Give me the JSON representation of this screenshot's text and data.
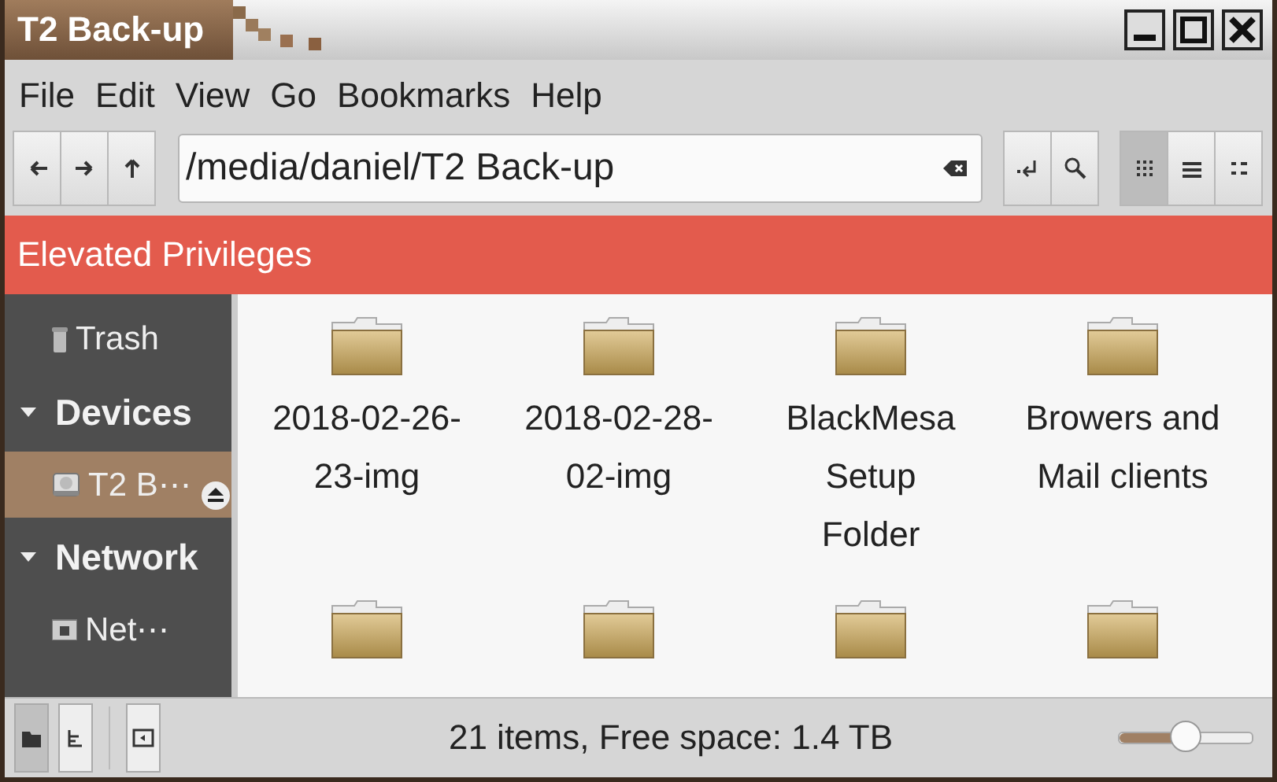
{
  "window": {
    "title": "T2 Back-up"
  },
  "menu": [
    "File",
    "Edit",
    "View",
    "Go",
    "Bookmarks",
    "Help"
  ],
  "toolbar": {
    "location": "/media/daniel/T2 Back-up",
    "views": [
      {
        "kind": "icons",
        "selected": true
      },
      {
        "kind": "list",
        "selected": false
      },
      {
        "kind": "compact",
        "selected": false
      }
    ]
  },
  "banner": "Elevated Privileges",
  "sidebar": [
    {
      "kind": "trash",
      "label": "Trash",
      "selected": false
    },
    {
      "kind": "header",
      "label": "Devices",
      "expanded": true
    },
    {
      "kind": "drive",
      "label": "T2 B⋯",
      "selected": true
    },
    {
      "kind": "header",
      "label": "Network",
      "expanded": true
    },
    {
      "kind": "network",
      "label": "Net⋯",
      "selected": false
    }
  ],
  "files": [
    {
      "kind": "folder",
      "name": "2018-02-26-23-img"
    },
    {
      "kind": "folder",
      "name": "2018-02-28-02-img"
    },
    {
      "kind": "folder",
      "name": "BlackMesa Setup Folder"
    },
    {
      "kind": "folder",
      "name": "Browers and Mail clients"
    },
    {
      "kind": "folder"
    },
    {
      "kind": "folder"
    },
    {
      "kind": "folder"
    },
    {
      "kind": "folder"
    }
  ],
  "status_bar": {
    "pane_modes": [
      {
        "kind": "places",
        "selected": true
      },
      {
        "kind": "tree",
        "selected": false
      }
    ],
    "text": "21 items, Free space: 1.4 TB",
    "zoom": {
      "level": 0.5
    }
  }
}
